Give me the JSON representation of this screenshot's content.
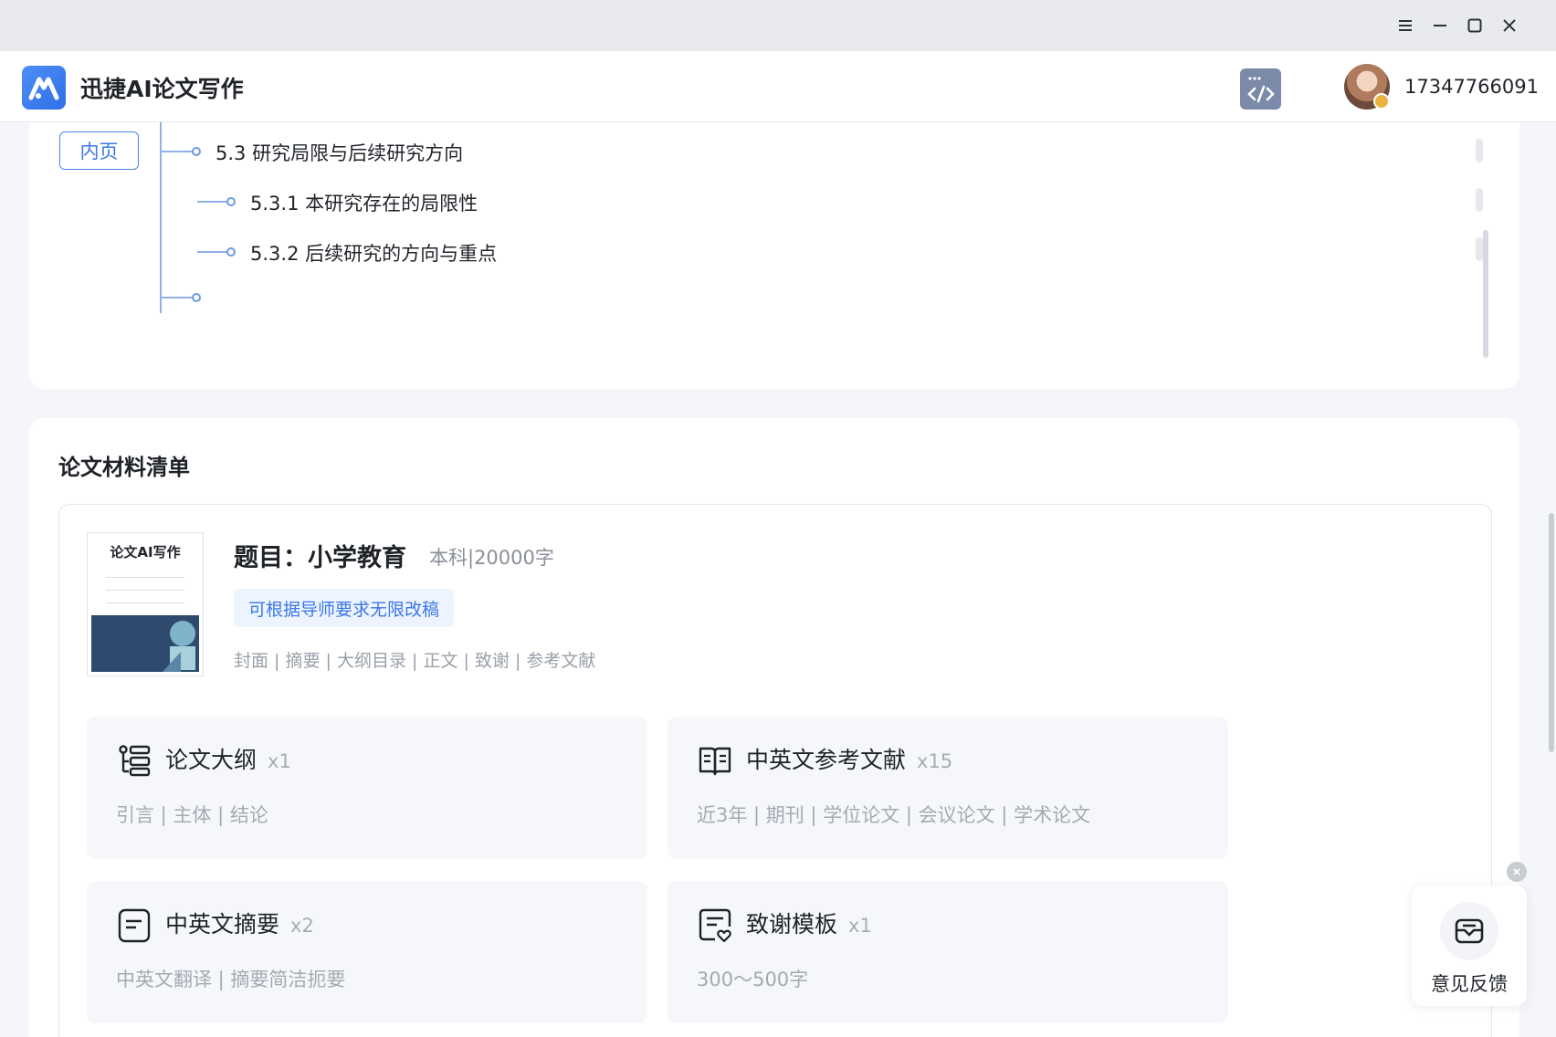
{
  "app": {
    "title": "迅捷AI论文写作"
  },
  "user": {
    "phone": "17347766091"
  },
  "outline": {
    "tag": "内页",
    "items": [
      {
        "label": "5.3 研究局限与后续研究方向"
      },
      {
        "label": "5.3.1 本研究存在的局限性"
      },
      {
        "label": "5.3.2 后续研究的方向与重点"
      }
    ]
  },
  "materials": {
    "section_title": "论文材料清单",
    "cover": {
      "title": "论文AI写作"
    },
    "topic": "题目：小学教育",
    "topic_meta": "本科|20000字",
    "revision_pill": "可根据导师要求无限改稿",
    "parts": "封面 | 摘要 | 大纲目录 | 正文 | 致谢 | 参考文献",
    "items": [
      {
        "name": "论文大纲",
        "count": "x1",
        "desc": "引言 | 主体 | 结论",
        "icon": "outline-icon"
      },
      {
        "name": "中英文参考文献",
        "count": "x15",
        "desc": "近3年 | 期刊 | 学位论文 | 会议论文 | 学术论文",
        "icon": "book-icon"
      },
      {
        "name": "中英文摘要",
        "count": "x2",
        "desc": "中英文翻译 | 摘要简洁扼要",
        "icon": "document-icon"
      },
      {
        "name": "致谢模板",
        "count": "x1",
        "desc": "300～500字",
        "icon": "thanks-icon"
      }
    ]
  },
  "feedback": {
    "label": "意见反馈"
  },
  "colors": {
    "accent": "#3b78e7",
    "tree_line": "#8fb1e8"
  }
}
